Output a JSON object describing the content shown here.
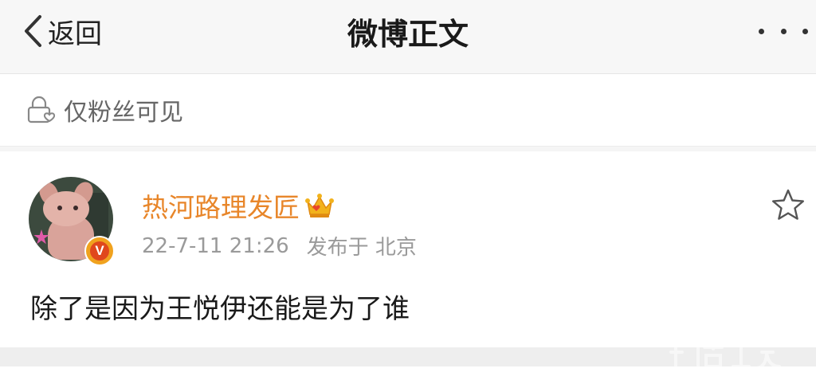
{
  "navbar": {
    "back_label": "返回",
    "title": "微博正文",
    "more_icon": "more-dots-icon"
  },
  "visibility": {
    "icon": "lock-heart-icon",
    "text": "仅粉丝可见"
  },
  "post": {
    "username": "热河路理发匠",
    "badge_icon": "crown-badge-icon",
    "verified_icon": "verified-v-icon",
    "verified_glyph": "V",
    "timestamp": "22-7-11 21:26",
    "posted_from": "发布于 北京",
    "content": "除了是因为王悦伊还能是为了谁",
    "favorite_icon": "star-outline-icon"
  },
  "colors": {
    "navbar_bg": "#f7f7f7",
    "username": "#e8862a",
    "meta_text": "#9a9a9a",
    "verified_badge": "#e0471c"
  }
}
